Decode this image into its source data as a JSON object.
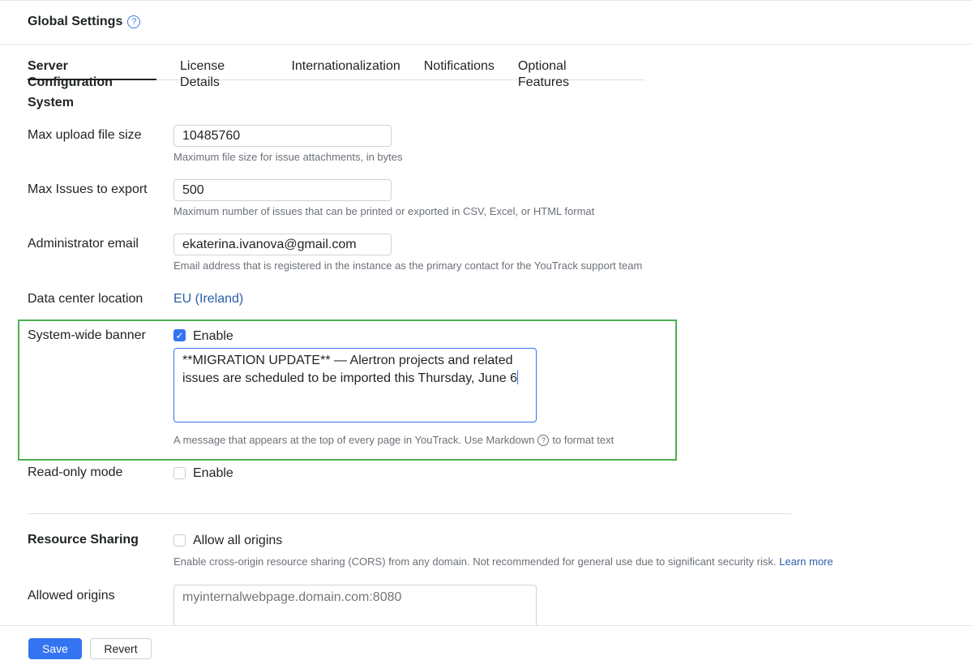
{
  "header": {
    "title": "Global Settings",
    "help_icon": "question-circle-icon"
  },
  "tabs": [
    {
      "label": "Server Configuration",
      "active": true
    },
    {
      "label": "License Details"
    },
    {
      "label": "Internationalization"
    },
    {
      "label": "Notifications"
    },
    {
      "label": "Optional Features"
    }
  ],
  "system": {
    "title": "System",
    "max_upload": {
      "label": "Max upload file size",
      "value": "10485760",
      "help": "Maximum file size for issue attachments, in bytes"
    },
    "max_export": {
      "label": "Max Issues to export",
      "value": "500",
      "help": "Maximum number of issues that can be printed or exported in CSV, Excel, or HTML format"
    },
    "admin_email": {
      "label": "Administrator email",
      "value": "ekaterina.ivanova@gmail.com",
      "help": "Email address that is registered in the instance as the primary contact for the YouTrack support team"
    },
    "data_center": {
      "label": "Data center location",
      "value": "EU (Ireland)"
    },
    "banner": {
      "label": "System-wide banner",
      "enable_label": "Enable",
      "enabled": true,
      "text": "**MIGRATION UPDATE** — Alertron projects and related issues are scheduled to be imported this Thursday, June 6",
      "help_before": "A message that appears at the top of every page in YouTrack. Use Markdown",
      "help_after": "to format text"
    },
    "read_only": {
      "label": "Read-only mode",
      "enable_label": "Enable",
      "enabled": false
    }
  },
  "resource_sharing": {
    "title": "Resource Sharing",
    "allow_all_label": "Allow all origins",
    "allow_all": false,
    "help": "Enable cross-origin resource sharing (CORS) from any domain. Not recommended for general use due to significant security risk.",
    "learn_more": "Learn more",
    "allowed_origins_label": "Allowed origins",
    "allowed_origins_placeholder": "myinternalwebpage.domain.com:8080"
  },
  "footer": {
    "save": "Save",
    "revert": "Revert"
  },
  "colors": {
    "accent": "#3574f0",
    "highlight": "#4caf50"
  }
}
